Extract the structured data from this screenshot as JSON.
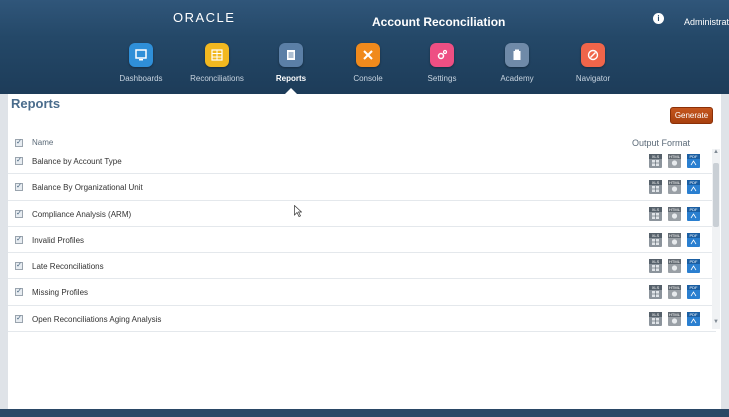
{
  "header": {
    "logo": "ORACLE",
    "app_title": "Account Reconciliation",
    "user_icon": "i",
    "user_name": "Administrator"
  },
  "nav": {
    "items": [
      {
        "label": "Dashboards",
        "icon": "dashboard-icon",
        "color": "#2f8fd8"
      },
      {
        "label": "Reconciliations",
        "icon": "reconciliations-icon",
        "color": "#f2b820"
      },
      {
        "label": "Reports",
        "icon": "reports-icon",
        "color": "#5b7fa6"
      },
      {
        "label": "Console",
        "icon": "console-icon",
        "color": "#f08a1c"
      },
      {
        "label": "Settings",
        "icon": "settings-icon",
        "color": "#ee4f83"
      },
      {
        "label": "Academy",
        "icon": "academy-icon",
        "color": "#6f8aa8"
      },
      {
        "label": "Navigator",
        "icon": "navigator-icon",
        "color": "#f0654a"
      }
    ],
    "active": "Reports"
  },
  "page": {
    "title": "Reports",
    "generate_label": "Generate"
  },
  "grid": {
    "header_name": "Name",
    "header_output": "Output Format",
    "rows": [
      {
        "name": "Balance by Account Type"
      },
      {
        "name": "Balance By Organizational Unit"
      },
      {
        "name": "Compliance Analysis (ARM)"
      },
      {
        "name": "Invalid Profiles"
      },
      {
        "name": "Late Reconciliations"
      },
      {
        "name": "Missing Profiles"
      },
      {
        "name": "Open Reconciliations Aging Analysis"
      }
    ],
    "formats": [
      "XLS",
      "HTML",
      "PDF"
    ]
  },
  "colors": {
    "header_bg": "#244868",
    "accent_orange": "#b84a17",
    "title_blue": "#4a6c8c"
  }
}
